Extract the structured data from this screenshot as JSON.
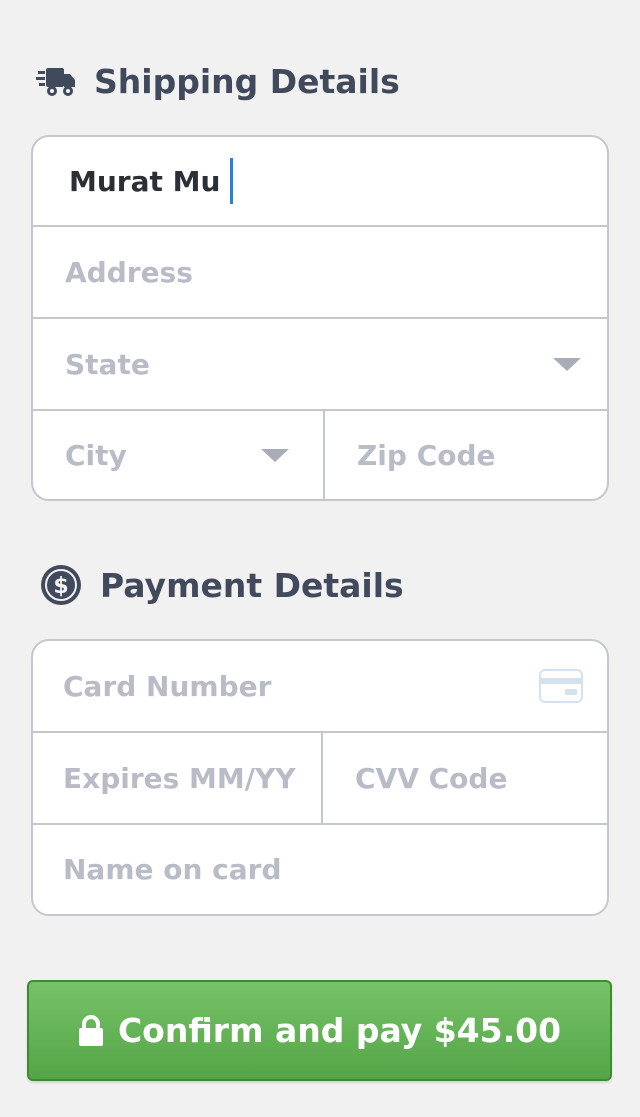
{
  "shipping": {
    "title": "Shipping Details",
    "icon": "truck-icon",
    "name_value": "Murat Mu",
    "address_placeholder": "Address",
    "state_placeholder": "State",
    "city_placeholder": "City",
    "zip_placeholder": "Zip Code"
  },
  "payment": {
    "title": "Payment Details",
    "icon": "dollar-coin-icon",
    "card_number_placeholder": "Card Number",
    "expires_placeholder": "Expires MM/YY",
    "cvv_placeholder": "CVV Code",
    "name_on_card_placeholder": "Name on card"
  },
  "confirm": {
    "label": "Confirm and pay $45.00",
    "icon": "lock-icon"
  },
  "colors": {
    "accent_green": "#5fb052",
    "heading": "#414a5c",
    "placeholder": "#b9bcc6",
    "caret": "#2a7fd8"
  }
}
